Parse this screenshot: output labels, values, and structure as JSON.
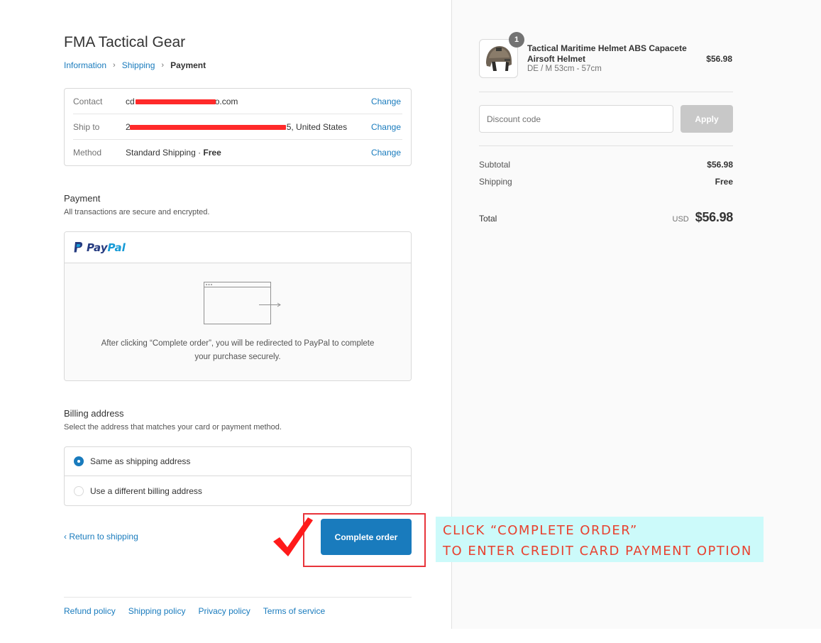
{
  "shop": {
    "name": "FMA Tactical Gear"
  },
  "breadcrumb": {
    "information": "Information",
    "shipping": "Shipping",
    "payment": "Payment"
  },
  "review": {
    "contact_label": "Contact",
    "contact_value_start": "cd",
    "contact_value_end": "o.com",
    "shipto_label": "Ship to",
    "shipto_value_start": "2",
    "shipto_value_end": "5, United States",
    "method_label": "Method",
    "method_value": "Standard Shipping · ",
    "method_free": "Free",
    "change_label": "Change"
  },
  "payment": {
    "title": "Payment",
    "subtitle": "All transactions are secure and encrypted.",
    "provider": {
      "part1": "Pay",
      "part2": "Pal"
    },
    "redirect_text": "After clicking “Complete order”, you will be redirected to PayPal to complete your purchase securely."
  },
  "billing": {
    "title": "Billing address",
    "subtitle": "Select the address that matches your card or payment method.",
    "options": [
      "Same as shipping address",
      "Use a different billing address"
    ],
    "selected_index": 0
  },
  "actions": {
    "return_label": "Return to shipping",
    "complete_label": "Complete order"
  },
  "annotation": {
    "line1": "CLICK “COMPLETE ORDER”",
    "line2": "TO ENTER CREDIT CARD PAYMENT OPTION",
    "text_color": "#e8412f",
    "background_color": "#ccfafa",
    "box_color": "#e8343b"
  },
  "footer": {
    "links": [
      "Refund policy",
      "Shipping policy",
      "Privacy policy",
      "Terms of service"
    ]
  },
  "summary": {
    "product": {
      "quantity": "1",
      "name": "Tactical Maritime Helmet ABS Capacete Airsoft Helmet",
      "variant": "DE / M 53cm - 57cm",
      "price": "$56.98"
    },
    "discount": {
      "placeholder": "Discount code",
      "apply_label": "Apply"
    },
    "subtotal_label": "Subtotal",
    "subtotal_value": "$56.98",
    "shipping_label": "Shipping",
    "shipping_value": "Free",
    "total_label": "Total",
    "total_currency": "USD",
    "total_value": "$56.98"
  },
  "colors": {
    "accent": "#197bbd",
    "redaction": "#ff2a2a"
  }
}
